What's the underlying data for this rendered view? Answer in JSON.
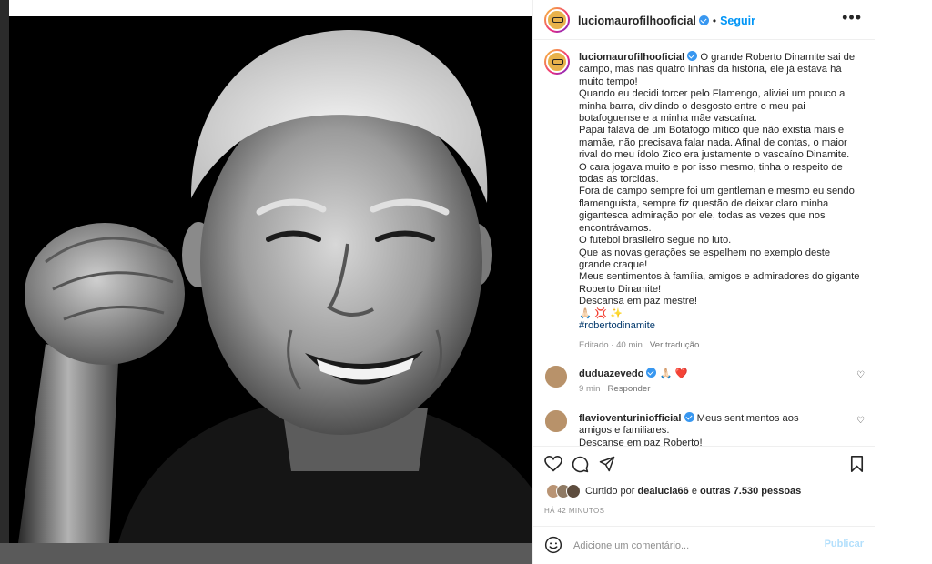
{
  "post": {
    "author": "luciomaurofilhooficial",
    "follow_label": "Seguir",
    "more_label": "•••",
    "caption": "O grande Roberto Dinamite sai de campo, mas nas quatro linhas da história, ele já estava há muito tempo!\nQuando eu decidi torcer pelo Flamengo, aliviei um pouco a minha barra, dividindo o desgosto entre o meu pai botafoguense e a minha mãe vascaína.\nPapai falava de um Botafogo mítico que não existia mais e mamãe, não precisava falar nada. Afinal de contas, o maior rival do meu ídolo Zico era justamente o vascaíno Dinamite.\nO cara jogava muito e por isso mesmo, tinha o respeito de todas as torcidas.\nFora de campo sempre foi um gentleman e mesmo eu sendo flamenguista, sempre fiz questão de deixar claro minha gigantesca admiração por ele, todas as vezes que nos encontrávamos.\nO futebol brasileiro segue no luto.\nQue as novas gerações se espelhem no exemplo deste grande craque!\nMeus sentimentos à família, amigos e admiradores do gigante Roberto Dinamite!\nDescansa em paz mestre!\n🙏🏻 💢 ✨",
    "hashtag": "#robertodinamite",
    "edited_label": "Editado",
    "edited_time": "40 min",
    "translation_label": "Ver tradução"
  },
  "comments": [
    {
      "user": "duduazevedo",
      "text": "🙏🏻 ❤️",
      "time": "9 min",
      "reply_label": "Responder"
    },
    {
      "user": "flavioventuriniofficial",
      "text": "Meus sentimentos aos amigos e familiares.\nDescanse em paz Roberto!"
    }
  ],
  "likes": {
    "prefix": "Curtido por",
    "user": "dealucia66",
    "middle": "e",
    "others": "outras 7.530 pessoas"
  },
  "time_ago": "HÁ 42 MINUTOS",
  "add_comment": {
    "placeholder": "Adicione um comentário...",
    "publish_label": "Publicar"
  },
  "colors": {
    "accent": "#0095f6",
    "verified": "#3897f0",
    "publish_disabled": "#b2dffc",
    "hashtag": "#00376b"
  },
  "icons": [
    "verified-icon",
    "more-icon",
    "heart-icon",
    "comment-icon",
    "share-icon",
    "bookmark-icon",
    "emoji-icon"
  ]
}
